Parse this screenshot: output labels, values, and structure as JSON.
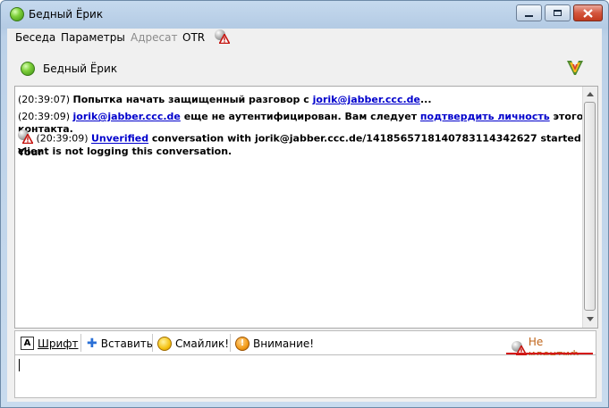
{
  "window": {
    "title": "Бедный Ёрик",
    "controls": [
      "minimize",
      "maximize",
      "close"
    ]
  },
  "menu": {
    "items": [
      {
        "label": "Беседа",
        "enabled": true
      },
      {
        "label": "Параметры",
        "enabled": true
      },
      {
        "label": "Адресат",
        "enabled": false
      },
      {
        "label": "OTR",
        "enabled": true
      }
    ]
  },
  "contact": {
    "name": "Бедный Ёрик",
    "status_color": "#5fbf22"
  },
  "messages": {
    "m1": {
      "time": "(20:39:07)",
      "text": "Попытка начать защищенный разговор с ",
      "link": "jorik@jabber.ccc.de",
      "suffix": "..."
    },
    "m2": {
      "time": "(20:39:09)",
      "link1": "jorik@jabber.ccc.de",
      "text": " еще не аутентифицирован. Вам следует ",
      "link2": "подтвердить личность",
      "suffix": " этого контакта."
    },
    "m3": {
      "time": "(20:39:09)",
      "link": "Unverified",
      "text1": " conversation with jorik@jabber.ccc.de/14185657181407831143426​27 started.  Your",
      "text2": "client is not logging this conversation."
    }
  },
  "toolbar": {
    "font_label": "Шрифт",
    "insert_label": "Вставить",
    "smiley_label": "Смайлик!",
    "attention_label": "Внимание!",
    "otr_status_label": "Не идентиф.",
    "otr_status_color": "#c0651a"
  },
  "input": {
    "value": ""
  }
}
